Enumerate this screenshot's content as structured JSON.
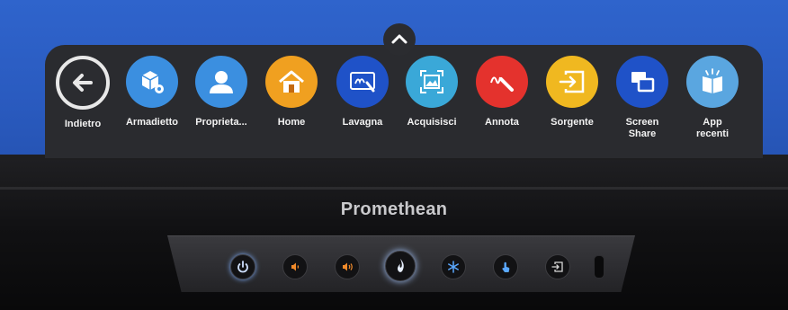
{
  "dock": {
    "items": [
      {
        "label": "Indietro",
        "icon": "back-arrow-icon",
        "color": "#2b2c30"
      },
      {
        "label": "Armadietto",
        "icon": "locker-cube-gear-icon",
        "color": "#3b8fe0"
      },
      {
        "label": "Proprieta...",
        "icon": "person-icon",
        "color": "#3b8fe0"
      },
      {
        "label": "Home",
        "icon": "home-icon",
        "color": "#f0a020"
      },
      {
        "label": "Lavagna",
        "icon": "whiteboard-icon",
        "color": "#1f52c8"
      },
      {
        "label": "Acquisisci",
        "icon": "capture-image-icon",
        "color": "#3aa8d8"
      },
      {
        "label": "Annota",
        "icon": "annotate-pen-icon",
        "color": "#e4322d"
      },
      {
        "label": "Sorgente",
        "icon": "source-input-icon",
        "color": "#f0b820"
      },
      {
        "label": "Screen\nShare",
        "icon": "screen-share-icon",
        "color": "#1f52c8"
      },
      {
        "label": "App\nrecenti",
        "icon": "recent-apps-book-icon",
        "color": "#5aa6e0"
      }
    ]
  },
  "bezel": {
    "brand": "Promethean",
    "buttons": [
      {
        "icon": "power-icon",
        "glow": "#7fb0ff"
      },
      {
        "icon": "volume-down-icon",
        "glow": "#f08a2a"
      },
      {
        "icon": "volume-up-icon",
        "glow": "#f08a2a"
      },
      {
        "icon": "promethean-logo-icon",
        "glow": "#a8c8ff"
      },
      {
        "icon": "freeze-icon",
        "glow": "#5aa8ff"
      },
      {
        "icon": "touch-icon",
        "glow": "#5aa8ff"
      },
      {
        "icon": "input-source-icon",
        "glow": "#d8d8d8"
      }
    ]
  }
}
